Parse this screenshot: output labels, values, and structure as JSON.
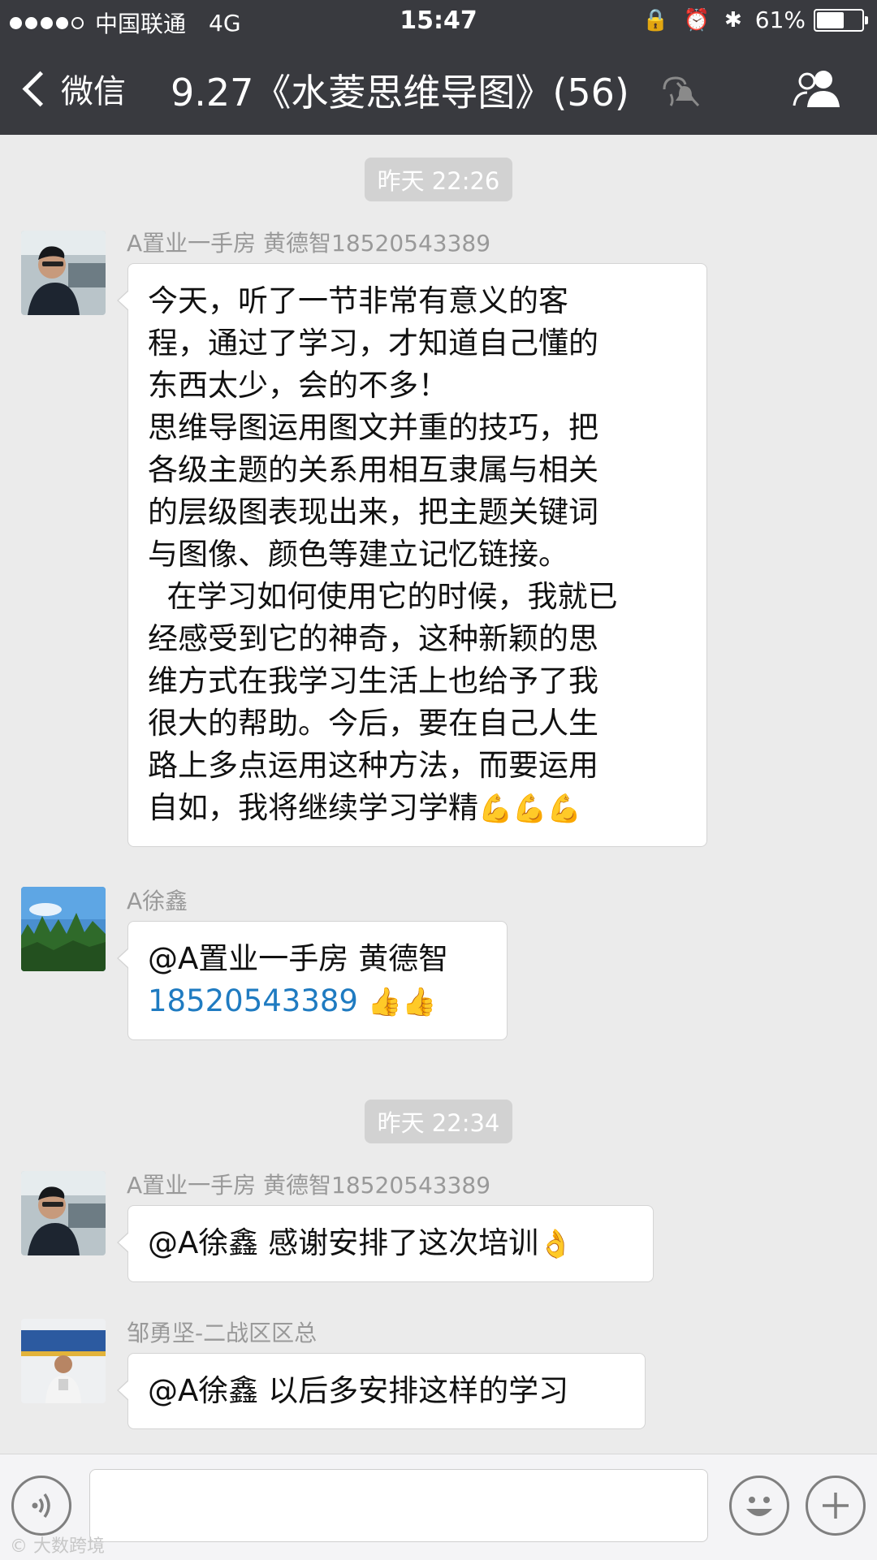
{
  "status_bar": {
    "carrier": "中国联通",
    "network": "4G",
    "time": "15:47",
    "battery_text": "61%",
    "battery_level": 0.61
  },
  "nav": {
    "back_label": "微信",
    "title": "9.27《水菱思维导图》(56)"
  },
  "messages": [
    {
      "timestamp": "昨天 22:26",
      "sender": "A置业一手房 黄德智18520543389",
      "lines": [
        "今天，听了一节非常有意义的客",
        "程，通过了学习，才知道自己懂的",
        "东西太少，会的不多！",
        "思维导图运用图文并重的技巧，把",
        "各级主题的关系用相互隶属与相关",
        "的层级图表现出来，把主题关键词",
        "与图像、颜色等建立记忆链接。",
        "  在学习如何使用它的时候，我就已",
        "经感受到它的神奇，这种新颖的思",
        "维方式在我学习生活上也给予了我",
        "很大的帮助。今后，要在自己人生",
        "路上多点运用这种方法，而要运用",
        "自如，我将继续学习学精"
      ],
      "emoji": "💪💪💪"
    },
    {
      "sender": "A徐鑫",
      "mention": "@A置业一手房 黄德智",
      "phone": "18520543389",
      "emoji": "👍👍"
    },
    {
      "timestamp": "昨天 22:34",
      "sender": "A置业一手房 黄德智18520543389",
      "text": "@A徐鑫 感谢安排了这次培训",
      "emoji": "👌"
    },
    {
      "sender": "邹勇坚-二战区区总",
      "text": "@A徐鑫 以后多安排这样的学习"
    }
  ],
  "input_bar": {
    "voice_icon": "voice-icon",
    "emoji_icon": "emoji-icon",
    "plus_icon": "plus-icon"
  },
  "watermark": "大数跨境"
}
